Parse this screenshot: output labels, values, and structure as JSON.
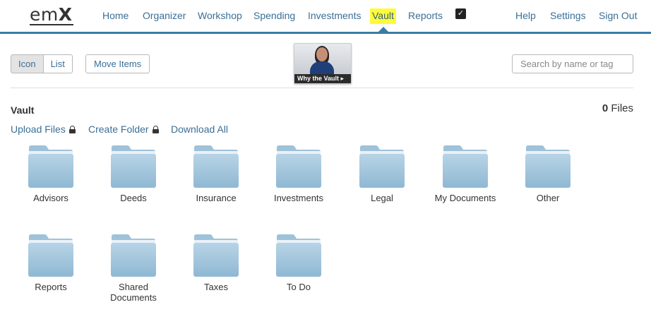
{
  "app": {
    "logo_text_a": "em",
    "logo_text_b": "X"
  },
  "nav": {
    "items": [
      {
        "label": "Home",
        "name": "nav-home"
      },
      {
        "label": "Organizer",
        "name": "nav-organizer"
      },
      {
        "label": "Workshop",
        "name": "nav-workshop"
      },
      {
        "label": "Spending",
        "name": "nav-spending"
      },
      {
        "label": "Investments",
        "name": "nav-investments"
      },
      {
        "label": "Vault",
        "name": "nav-vault",
        "active": true
      },
      {
        "label": "Reports",
        "name": "nav-reports"
      }
    ],
    "right_items": [
      {
        "label": "Help"
      },
      {
        "label": "Settings"
      },
      {
        "label": "Sign Out"
      }
    ],
    "active_highlight_color": "#fffb3a",
    "accent_color": "#3a7ca5"
  },
  "toolbar": {
    "icon_view_label": "Icon",
    "list_view_label": "List",
    "move_items_label": "Move Items",
    "video_caption": "Why the Vault ▸",
    "search_placeholder": "Search by name or tag"
  },
  "vault": {
    "title": "Vault",
    "file_count": "0",
    "file_count_label": "Files",
    "actions": {
      "upload": "Upload Files",
      "create_folder": "Create Folder",
      "download_all": "Download All"
    },
    "folders": [
      {
        "label": "Advisors"
      },
      {
        "label": "Deeds"
      },
      {
        "label": "Insurance"
      },
      {
        "label": "Investments"
      },
      {
        "label": "Legal"
      },
      {
        "label": "My Documents"
      },
      {
        "label": "Other"
      },
      {
        "label": "Reports"
      },
      {
        "label": "Shared Documents"
      },
      {
        "label": "Taxes"
      },
      {
        "label": "To Do"
      }
    ]
  }
}
